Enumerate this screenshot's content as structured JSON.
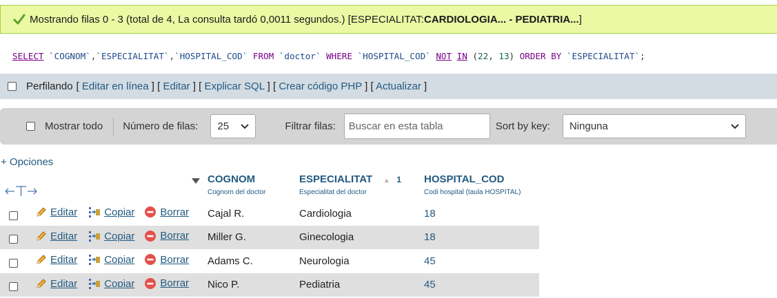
{
  "message": {
    "text": "Mostrando filas 0 - 3 (total de 4, La consulta tardó 0,0011 segundos.) [ESPECIALITAT: ",
    "range_bold": "CARDIOLOGIA... - PEDIATRIA...",
    "close": "]",
    "icon": "check-icon"
  },
  "sql": {
    "tokens": [
      [
        "kw-u",
        "SELECT"
      ],
      [
        "pun",
        " "
      ],
      [
        "id",
        "`COGNOM`"
      ],
      [
        "pun",
        ","
      ],
      [
        "id",
        "`ESPECIALITAT`"
      ],
      [
        "pun",
        ","
      ],
      [
        "id",
        "`HOSPITAL_COD`"
      ],
      [
        "pun",
        " "
      ],
      [
        "kw",
        "FROM"
      ],
      [
        "pun",
        " "
      ],
      [
        "id",
        "`doctor`"
      ],
      [
        "pun",
        " "
      ],
      [
        "kw",
        "WHERE"
      ],
      [
        "pun",
        " "
      ],
      [
        "id",
        "`HOSPITAL_COD`"
      ],
      [
        "pun",
        " "
      ],
      [
        "kw-u",
        "NOT"
      ],
      [
        "pun",
        " "
      ],
      [
        "kw-u",
        "IN"
      ],
      [
        "pun",
        " ("
      ],
      [
        "num",
        "22"
      ],
      [
        "pun",
        ", "
      ],
      [
        "num",
        "13"
      ],
      [
        "pun",
        ") "
      ],
      [
        "kw",
        "ORDER BY"
      ],
      [
        "pun",
        " "
      ],
      [
        "id",
        "`ESPECIALITAT`"
      ],
      [
        "pun",
        ";"
      ]
    ]
  },
  "profiling": {
    "label": "Perfilando",
    "links": [
      "Editar en línea",
      "Editar",
      "Explicar SQL",
      "Crear código PHP",
      "Actualizar"
    ]
  },
  "nav": {
    "show_all": "Mostrar todo",
    "rows_label": "Número de filas:",
    "rows_value": "25",
    "filter_label": "Filtrar filas:",
    "filter_placeholder": "Buscar en esta tabla",
    "sort_label": "Sort by key:",
    "sort_value": "Ninguna"
  },
  "options_link": "+ Opciones",
  "table": {
    "columns": [
      {
        "name": "COGNOM",
        "comment": "Cognom del doctor"
      },
      {
        "name": "ESPECIALITAT",
        "comment": "Especialitat del doctor",
        "sort_order": "1"
      },
      {
        "name": "HOSPITAL_COD",
        "comment": "Codi hospital (taula HOSPITAL)"
      }
    ],
    "actions": {
      "edit": "Editar",
      "copy": "Copiar",
      "delete": "Borrar"
    },
    "rows": [
      {
        "cognom": "Cajal R.",
        "especialitat": "Cardiologia",
        "hospital_cod": "18"
      },
      {
        "cognom": "Miller G.",
        "especialitat": "Ginecologia",
        "hospital_cod": "18"
      },
      {
        "cognom": "Adams C.",
        "especialitat": "Neurologia",
        "hospital_cod": "45"
      },
      {
        "cognom": "Nico P.",
        "especialitat": "Pediatria",
        "hospital_cod": "45"
      }
    ]
  }
}
